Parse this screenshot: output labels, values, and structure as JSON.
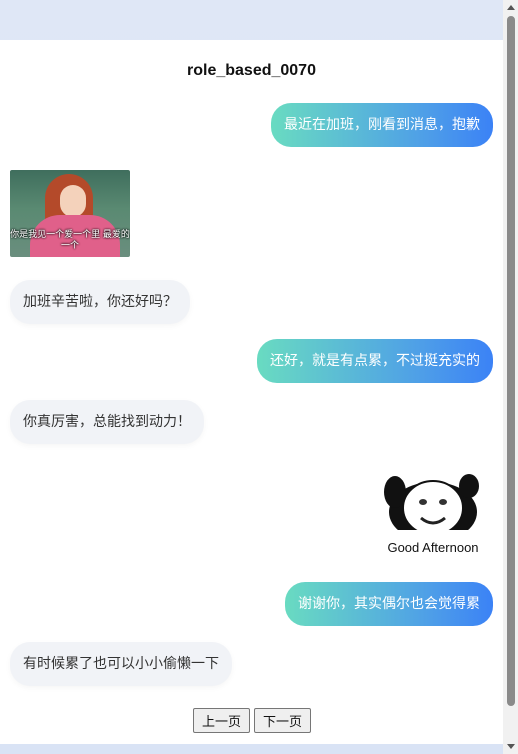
{
  "page": {
    "title": "role_based_0070"
  },
  "messages": [
    {
      "role": "me",
      "text": "最近在加班，刚看到消息，抱歉"
    },
    {
      "role": "them",
      "sticker": "anime-woman-sticker",
      "caption": "你是我见一个爱一个里 最爱的一个"
    },
    {
      "role": "them",
      "text": "加班辛苦啦，你还好吗？"
    },
    {
      "role": "me",
      "text": "还好，就是有点累，不过挺充实的"
    },
    {
      "role": "them",
      "text": "你真厉害，总能找到动力！"
    },
    {
      "role": "me",
      "sticker": "panda-meme-sticker",
      "caption": "Good Afternoon"
    },
    {
      "role": "me",
      "text": "谢谢你，其实偶尔也会觉得累"
    },
    {
      "role": "them",
      "text": "有时候累了也可以小小偷懒一下"
    }
  ],
  "pagination": {
    "prev_label": "上一页",
    "next_label": "下一页"
  },
  "colors": {
    "me_gradient_start": "#69dbc1",
    "me_gradient_end": "#3b82f6",
    "them_bubble": "#f1f3f7"
  }
}
